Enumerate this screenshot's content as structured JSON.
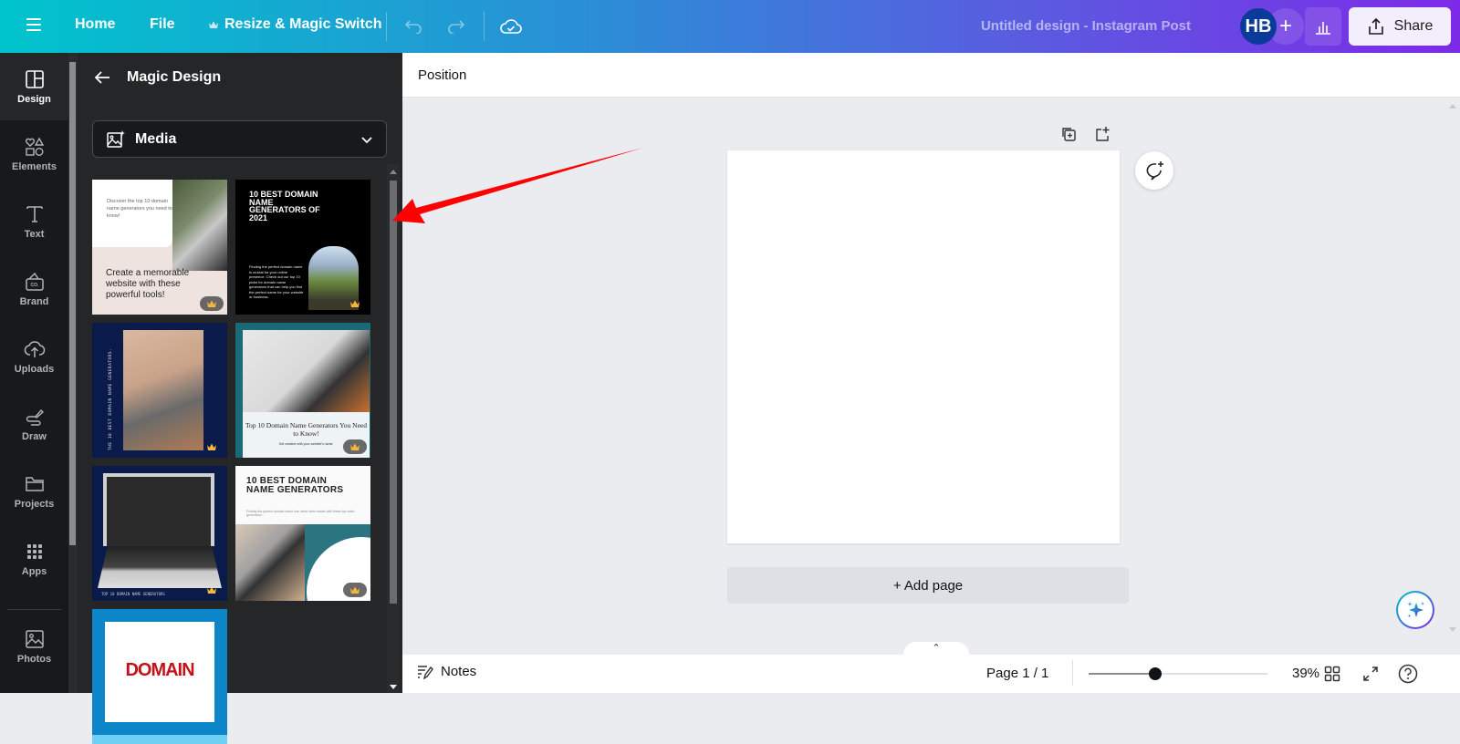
{
  "topbar": {
    "home": "Home",
    "file": "File",
    "resize": "Resize & Magic Switch",
    "design_title": "Untitled design - Instagram Post",
    "avatar_initials": "HB",
    "share": "Share",
    "gradient": [
      "#00c4cc",
      "#7d2ae8"
    ]
  },
  "rail": {
    "items": [
      {
        "label": "Design",
        "icon": "design-icon",
        "active": true
      },
      {
        "label": "Elements",
        "icon": "elements-icon"
      },
      {
        "label": "Text",
        "icon": "text-icon"
      },
      {
        "label": "Brand",
        "icon": "brand-icon"
      },
      {
        "label": "Uploads",
        "icon": "uploads-icon"
      },
      {
        "label": "Draw",
        "icon": "draw-icon"
      },
      {
        "label": "Projects",
        "icon": "projects-icon"
      },
      {
        "label": "Apps",
        "icon": "apps-icon"
      },
      {
        "label": "Photos",
        "icon": "photos-icon"
      }
    ]
  },
  "panel": {
    "title": "Magic Design",
    "media_select": "Media",
    "templates": [
      {
        "small_text": "Discover the top 10 domain name generators you need to know!",
        "headline": "Create a memorable website with these powerful tools!",
        "premium": true
      },
      {
        "headline": "10 BEST DOMAIN NAME GENERATORS OF 2021",
        "body": "Finding the perfect domain name is crucial for your online presence. Check out our top 10 picks for domain name generators that can help you find the perfect name for your website or business.",
        "premium": true
      },
      {
        "vertical_text": "THE 10 BEST DOMAIN NAME GENERATORS.",
        "premium": true
      },
      {
        "headline": "Top 10 Domain Name Generators You Need to Know!",
        "sub": "Get creative with your website's name.",
        "premium": true
      },
      {
        "footer": "TOP 10 DOMAIN NAME GENERATORS",
        "premium": true
      },
      {
        "headline": "10 BEST DOMAIN NAME GENERATORS",
        "sub": "Finding the perfect domain name has never been easier with these top-rated generators.",
        "premium": true
      },
      {
        "word": "DOMAIN",
        "premium": false
      }
    ]
  },
  "context_bar": {
    "position": "Position"
  },
  "canvas": {
    "add_page": "+ Add page"
  },
  "bottombar": {
    "notes": "Notes",
    "page_count": "Page 1 / 1",
    "zoom_percent": 39,
    "zoom_label": "39%",
    "zoom_slider_fraction": 0.37
  },
  "annotation": {
    "arrow_color": "#ff0000"
  }
}
